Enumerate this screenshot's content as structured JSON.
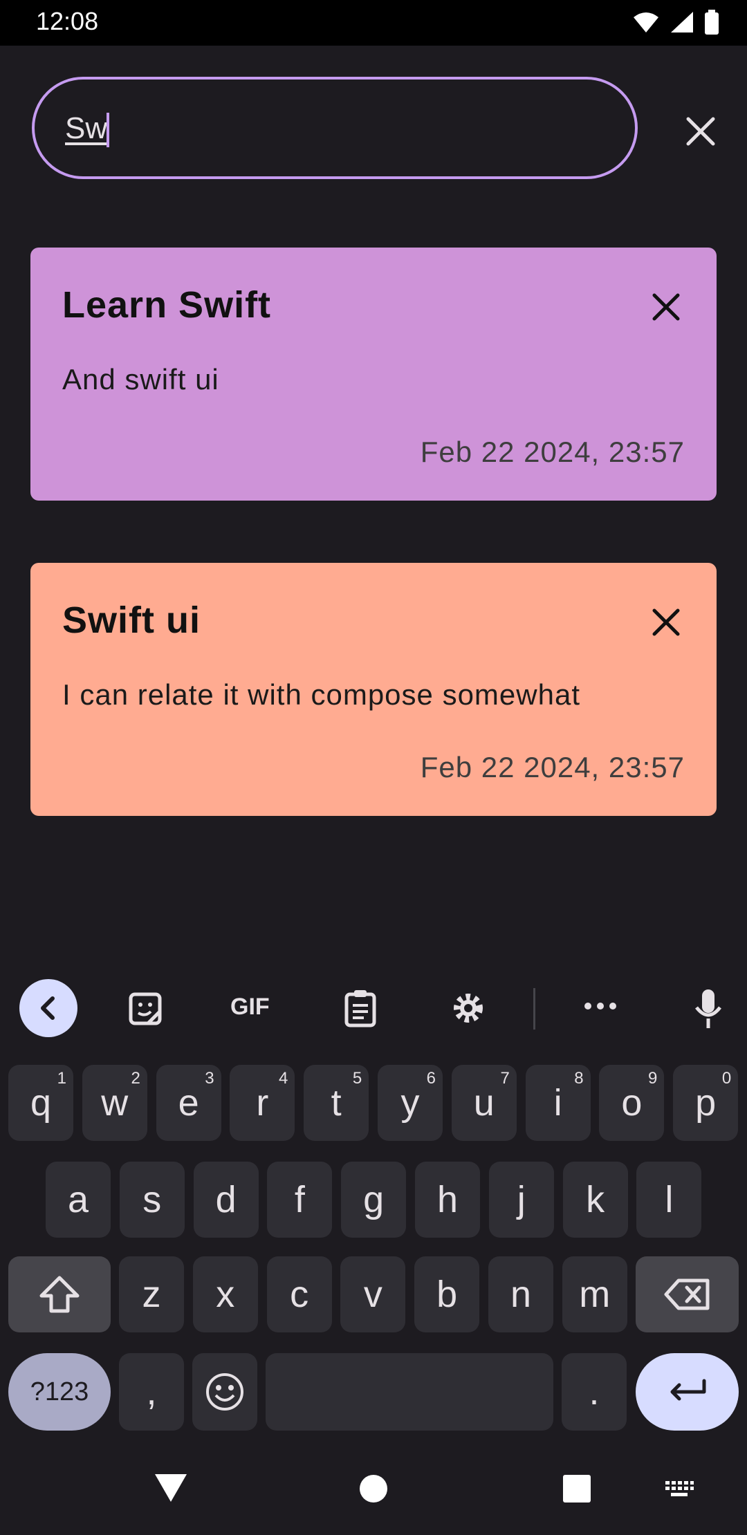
{
  "status_bar": {
    "time": "12:08"
  },
  "search": {
    "value": "Sw"
  },
  "notes": [
    {
      "title": "Learn Swift",
      "body": "And swift ui",
      "date": "Feb 22 2024, 23:57",
      "color": "#ce93d8"
    },
    {
      "title": "Swift ui",
      "body": "I can relate it with compose somewhat",
      "date": "Feb 22 2024, 23:57",
      "color": "#ffab91"
    }
  ],
  "keyboard": {
    "toolbar": [
      "back-icon",
      "sticker-icon",
      "gif-label",
      "clipboard-icon",
      "settings-icon",
      "more-icon",
      "mic-icon"
    ],
    "gif_label": "GIF",
    "row1": [
      {
        "k": "q",
        "h": "1"
      },
      {
        "k": "w",
        "h": "2"
      },
      {
        "k": "e",
        "h": "3"
      },
      {
        "k": "r",
        "h": "4"
      },
      {
        "k": "t",
        "h": "5"
      },
      {
        "k": "y",
        "h": "6"
      },
      {
        "k": "u",
        "h": "7"
      },
      {
        "k": "i",
        "h": "8"
      },
      {
        "k": "o",
        "h": "9"
      },
      {
        "k": "p",
        "h": "0"
      }
    ],
    "row2": [
      "a",
      "s",
      "d",
      "f",
      "g",
      "h",
      "j",
      "k",
      "l"
    ],
    "row3": [
      "z",
      "x",
      "c",
      "v",
      "b",
      "n",
      "m"
    ],
    "symbols_label": "?123",
    "comma": ",",
    "period": "."
  },
  "colors": {
    "background": "#1d1b20",
    "accent": "#c59bf0",
    "key": "#2f2e34",
    "key_special": "#46454b",
    "enter": "#d7dcff"
  }
}
